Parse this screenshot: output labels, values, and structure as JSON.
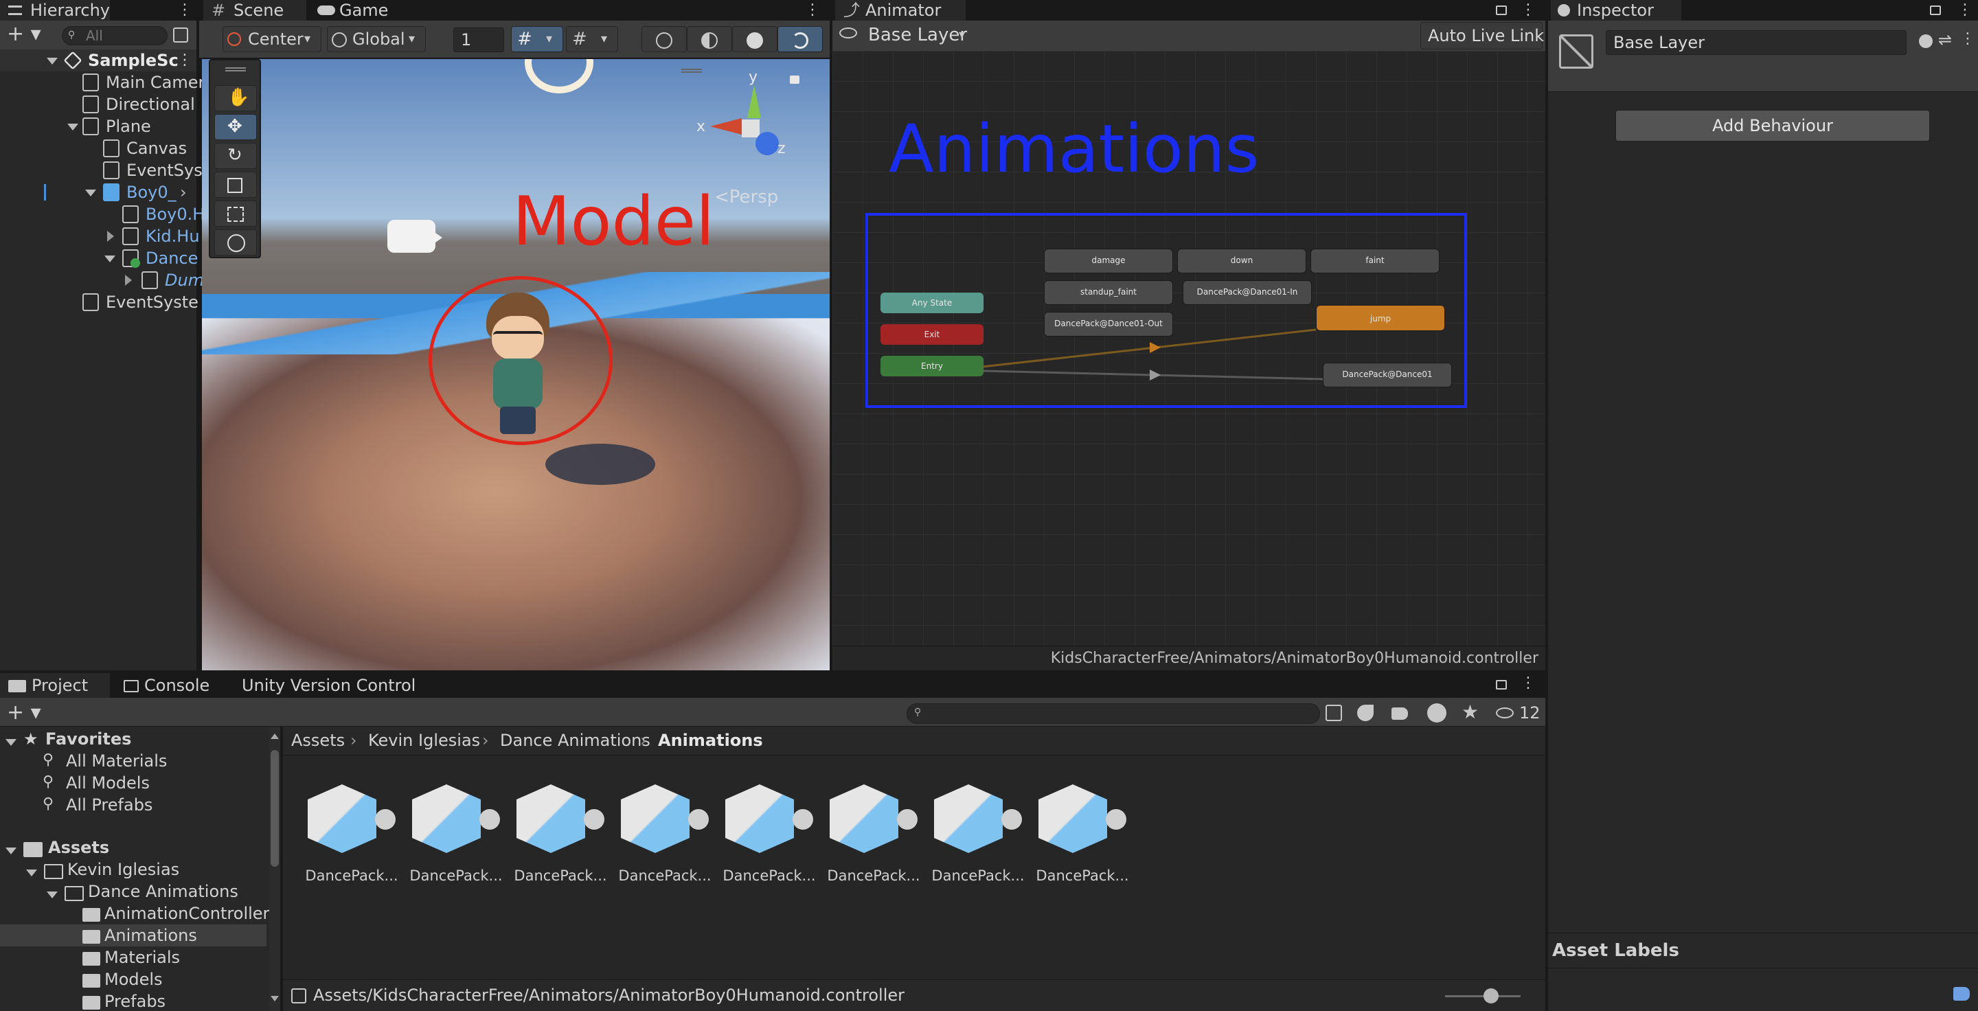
{
  "hierarchy": {
    "tab_label": "Hierarchy",
    "search_placeholder": "All",
    "items": [
      {
        "label": "SampleSc",
        "type": "scene"
      },
      {
        "label": "Main Camer"
      },
      {
        "label": "Directional"
      },
      {
        "label": "Plane"
      },
      {
        "label": "Canvas"
      },
      {
        "label": "EventSys"
      },
      {
        "label": "Boy0_"
      },
      {
        "label": "Boy0.H"
      },
      {
        "label": "Kid.Hu"
      },
      {
        "label": "Dance"
      },
      {
        "label": "Dum"
      },
      {
        "label": "EventSyste"
      }
    ]
  },
  "scene": {
    "tab_scene": "Scene",
    "tab_game": "Game",
    "pivot_label": "Center",
    "space_label": "Global",
    "grid_value": "1",
    "gizmo_labels": {
      "y": "y",
      "x": "x",
      "z": "z"
    },
    "persp_label": "<Persp",
    "overlay_text": "Model",
    "overlay_color": "#e0251b"
  },
  "animator": {
    "tab_label": "Animator",
    "layer_label": "Base Layer",
    "live_link_label": "Auto Live Link",
    "overlay_text": "Animations",
    "overlay_color": "#1a2cf0",
    "footer_path": "KidsCharacterFree/Animators/AnimatorBoy0Humanoid.controller",
    "states": {
      "damage": "damage",
      "down": "down",
      "faint": "faint",
      "any_state": "Any State",
      "standup_faint": "standup_faint",
      "dance_in": "DancePack@Dance01-In",
      "exit": "Exit",
      "jump": "jump",
      "dance_out": "DancePack@Dance01-Out",
      "entry": "Entry",
      "dance01": "DancePack@Dance01"
    }
  },
  "inspector": {
    "tab_label": "Inspector",
    "name_value": "Base Layer",
    "add_behaviour_label": "Add Behaviour",
    "asset_labels_title": "Asset Labels"
  },
  "project": {
    "tab_project": "Project",
    "tab_console": "Console",
    "tab_vcs": "Unity Version Control",
    "hidden_count": "12",
    "favorites_title": "Favorites",
    "favorites": [
      "All Materials",
      "All Models",
      "All Prefabs"
    ],
    "assets_title": "Assets",
    "tree": [
      "Kevin Iglesias",
      "Dance Animations",
      "AnimationControllers",
      "Animations",
      "Materials",
      "Models",
      "Prefabs"
    ],
    "breadcrumb": [
      "Assets",
      "Kevin Iglesias",
      "Dance Animations",
      "Animations"
    ],
    "asset_items": [
      "DancePack...",
      "DancePack...",
      "DancePack...",
      "DancePack...",
      "DancePack...",
      "DancePack...",
      "DancePack...",
      "DancePack..."
    ],
    "status_path": "Assets/KidsCharacterFree/Animators/AnimatorBoy0Humanoid.controller"
  },
  "colors": {
    "selection_blue": "#2c5d87",
    "model_circle": "#e0251b",
    "animations_box": "#1a2cf0",
    "entry_green": "#3a7a3a",
    "exit_red": "#a32424",
    "jump_orange": "#c57a21"
  }
}
